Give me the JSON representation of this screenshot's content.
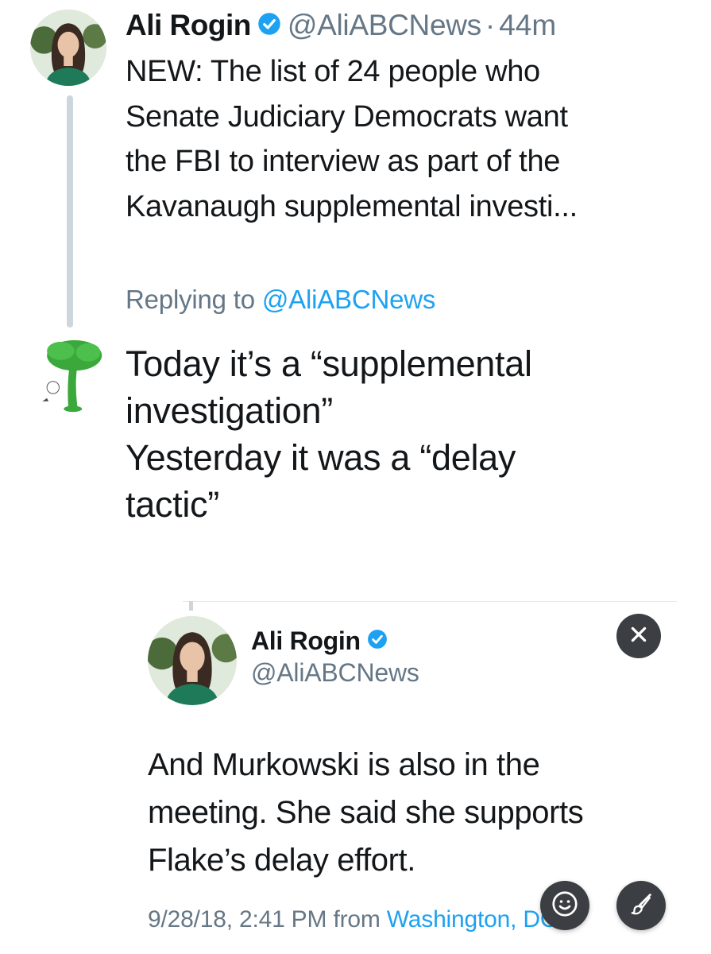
{
  "tweet": {
    "author_name": "Ali Rogin",
    "handle": "@AliABCNews",
    "separator": "·",
    "time": "44m",
    "text_lines": [
      "NEW: The list of 24 people who",
      "Senate Judiciary Democrats want",
      "the FBI to interview as part of the",
      "Kavanaugh supplemental investi..."
    ]
  },
  "reply": {
    "replying_prefix": "Replying to",
    "replying_handle": "@AliABCNews",
    "text_lines": [
      "Today it’s a “supplemental",
      "investigation”",
      "Yesterday it was a “delay",
      "tactic”"
    ]
  },
  "quoted": {
    "author_name": "Ali Rogin",
    "handle": "@AliABCNews",
    "text_lines": [
      "And Murkowski is also in the",
      "meeting. She said she supports",
      "Flake’s delay effort."
    ],
    "date": "9/28/18, 2:41 PM",
    "from": "from",
    "location": "Washington, DC"
  },
  "icons": {
    "verified": "verified-badge-icon",
    "close": "close-icon",
    "emoji": "emoji-icon",
    "brush": "brush-icon"
  },
  "colors": {
    "text": "#14171a",
    "muted": "#657786",
    "link": "#1da1f2",
    "verified": "#1da1f2",
    "thread_line": "#cdd6dd",
    "fab": "#3b3f43"
  }
}
